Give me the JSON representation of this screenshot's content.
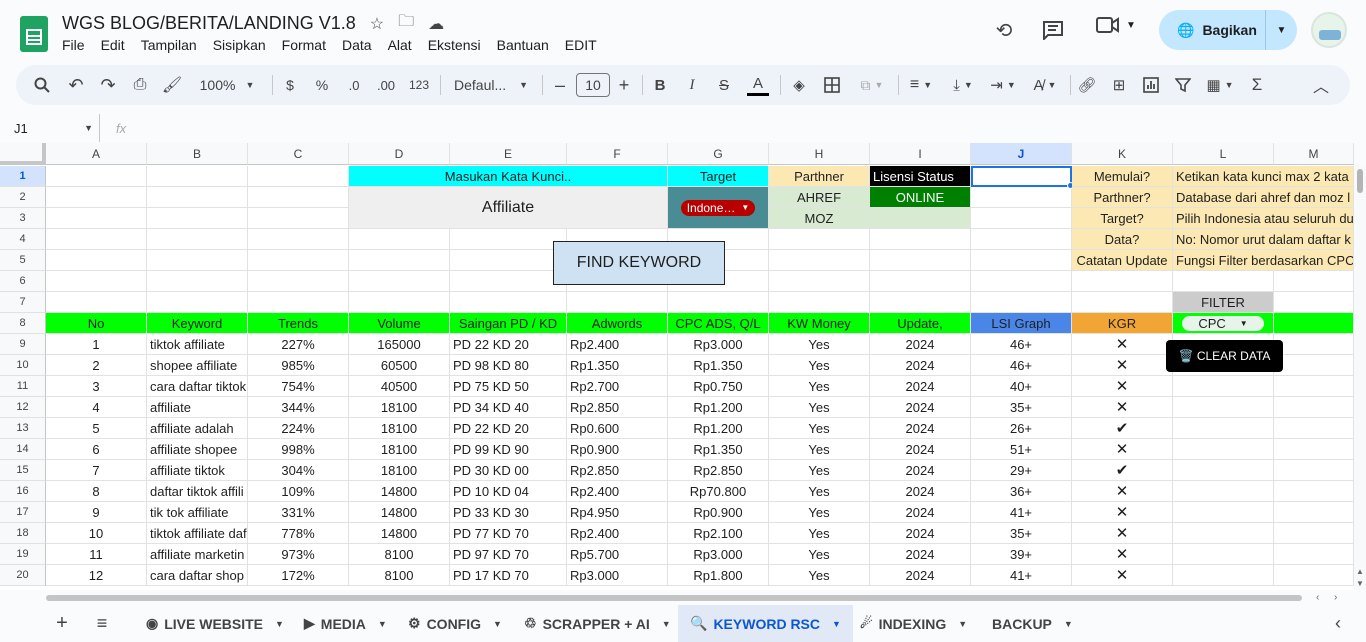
{
  "doc": {
    "title": "WGS BLOG/BERITA/LANDING V1.8"
  },
  "menu": [
    "File",
    "Edit",
    "Tampilan",
    "Sisipkan",
    "Format",
    "Data",
    "Alat",
    "Ekstensi",
    "Bantuan",
    "EDIT"
  ],
  "share": {
    "label": "Bagikan"
  },
  "toolbar": {
    "zoom": "100%",
    "currency": "$",
    "percent": "%",
    "dec_down": ".0",
    "dec_up": ".00",
    "num_format": "123",
    "font": "Defaul...",
    "font_size": "10",
    "minus": "–",
    "plus": "+",
    "bold": "B",
    "italic": "I",
    "strike": "S",
    "textcolor": "A",
    "sigma": "Σ"
  },
  "formula": {
    "namebox": "J1",
    "fx": "fx",
    "value": ""
  },
  "columns": [
    "A",
    "B",
    "C",
    "D",
    "E",
    "F",
    "G",
    "H",
    "I",
    "J",
    "K",
    "L",
    "M"
  ],
  "rows": [
    "1",
    "2",
    "3",
    "4",
    "5",
    "6",
    "7",
    "8",
    "9",
    "10",
    "11",
    "12",
    "13",
    "14",
    "15",
    "16",
    "17",
    "18",
    "19",
    "20"
  ],
  "header": {
    "masukan": "Masukan Kata Kunci..",
    "target": "Target",
    "parthner": "Parthner",
    "lisensi": "Lisensi Status",
    "keyword_input": "Affiliate",
    "target_select": "Indone…",
    "ahref": "AHREF",
    "status": "ONLINE",
    "moz": "MOZ",
    "find_btn": "FIND KEYWORD",
    "filter": "FILTER",
    "filter_select": "CPC",
    "clear_btn": "🗑️ CLEAR DATA"
  },
  "help": [
    {
      "q": "Memulai?",
      "a": "Ketikan kata kunci max 2 kata"
    },
    {
      "q": "Parthner?",
      "a": "Database dari ahref dan moz l"
    },
    {
      "q": "Target?",
      "a": "Pilih Indonesia atau seluruh du"
    },
    {
      "q": "Data?",
      "a": "No: Nomor urut dalam daftar k"
    },
    {
      "q": "Catatan Update",
      "a": "Fungsi Filter berdasarkan CPC"
    }
  ],
  "table": {
    "headers": [
      "No",
      "Keyword",
      "Trends",
      "Volume",
      "Saingan PD / KD",
      "Adwords",
      "CPC ADS, Q/L",
      "KW Money",
      "Update,",
      "LSI Graph",
      "KGR"
    ],
    "rows": [
      [
        "1",
        "tiktok affiliate",
        "227%",
        "165000",
        "PD 22 KD 20",
        "Rp2.400",
        "Rp3.000",
        "Yes",
        "2024",
        "46+",
        "✕"
      ],
      [
        "2",
        "shopee affiliate",
        "985%",
        "60500",
        "PD 98 KD 80",
        "Rp1.350",
        "Rp1.350",
        "Yes",
        "2024",
        "46+",
        "✕"
      ],
      [
        "3",
        "cara daftar tiktok",
        "754%",
        "40500",
        "PD 75 KD 50",
        "Rp2.700",
        "Rp0.750",
        "Yes",
        "2024",
        "40+",
        "✕"
      ],
      [
        "4",
        "affiliate",
        "344%",
        "18100",
        "PD 34 KD 40",
        "Rp2.850",
        "Rp1.200",
        "Yes",
        "2024",
        "35+",
        "✕"
      ],
      [
        "5",
        "affiliate adalah",
        "224%",
        "18100",
        "PD 22 KD 20",
        "Rp0.600",
        "Rp1.200",
        "Yes",
        "2024",
        "26+",
        "✔"
      ],
      [
        "6",
        "affiliate shopee",
        "998%",
        "18100",
        "PD 99 KD 90",
        "Rp0.900",
        "Rp1.350",
        "Yes",
        "2024",
        "51+",
        "✕"
      ],
      [
        "7",
        "affiliate tiktok",
        "304%",
        "18100",
        "PD 30 KD 00",
        "Rp2.850",
        "Rp2.850",
        "Yes",
        "2024",
        "29+",
        "✔"
      ],
      [
        "8",
        "daftar tiktok affili",
        "109%",
        "14800",
        "PD 10 KD 04",
        "Rp2.400",
        "Rp70.800",
        "Yes",
        "2024",
        "36+",
        "✕"
      ],
      [
        "9",
        "tik tok affiliate",
        "331%",
        "14800",
        "PD 33 KD 30",
        "Rp4.950",
        "Rp0.900",
        "Yes",
        "2024",
        "41+",
        "✕"
      ],
      [
        "10",
        "tiktok affiliate daf",
        "778%",
        "14800",
        "PD 77 KD 70",
        "Rp2.400",
        "Rp2.100",
        "Yes",
        "2024",
        "35+",
        "✕"
      ],
      [
        "11",
        "affiliate marketin",
        "973%",
        "8100",
        "PD 97 KD 70",
        "Rp5.700",
        "Rp3.000",
        "Yes",
        "2024",
        "39+",
        "✕"
      ],
      [
        "12",
        "cara daftar shop",
        "172%",
        "8100",
        "PD 17 KD 70",
        "Rp3.000",
        "Rp1.800",
        "Yes",
        "2024",
        "41+",
        "✕"
      ]
    ]
  },
  "tabs": [
    {
      "label": "LIVE WEBSITE",
      "icon": "◉"
    },
    {
      "label": "MEDIA",
      "icon": "▶"
    },
    {
      "label": "CONFIG",
      "icon": "⚙"
    },
    {
      "label": "SCRAPPER + AI",
      "icon": "♲"
    },
    {
      "label": "KEYWORD RSC",
      "icon": "🔍"
    },
    {
      "label": "INDEXING",
      "icon": "☄"
    },
    {
      "label": "BACKUP",
      "icon": ""
    }
  ],
  "active_tab": 4,
  "colors": {
    "cyan": "#00ffff",
    "green": "#00ff00",
    "blue_lsi": "#4a86e8",
    "orange_kgr": "#f1a535",
    "teal": "#4a8c94",
    "accent": "#0b57d0"
  }
}
